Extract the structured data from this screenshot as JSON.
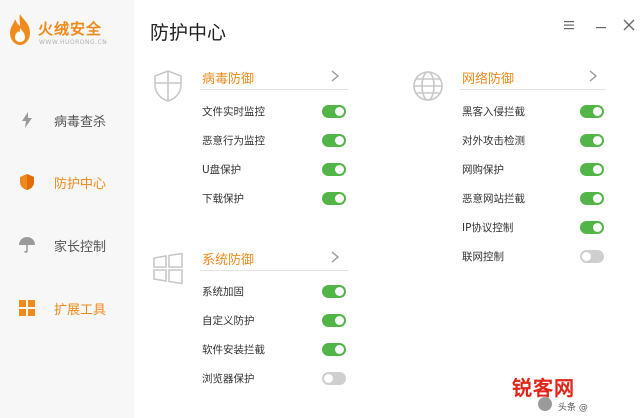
{
  "app": {
    "name": "火绒安全",
    "subtitle": "WWW.HUORONG.CN",
    "brand_color": "#f08a1c"
  },
  "sidebar": {
    "items": [
      {
        "label": "病毒查杀",
        "icon": "lightning-icon"
      },
      {
        "label": "防护中心",
        "icon": "shield-icon",
        "active": true
      },
      {
        "label": "家长控制",
        "icon": "umbrella-icon"
      },
      {
        "label": "扩展工具",
        "icon": "grid-icon"
      }
    ]
  },
  "page": {
    "title": "防护中心"
  },
  "window_controls": [
    "menu-icon",
    "minimize-icon",
    "close-icon"
  ],
  "sections": {
    "virus": {
      "title": "病毒防御",
      "icon": "shield-outline-icon",
      "items": [
        {
          "label": "文件实时监控",
          "on": true
        },
        {
          "label": "恶意行为监控",
          "on": true
        },
        {
          "label": "U盘保护",
          "on": true
        },
        {
          "label": "下载保护",
          "on": true
        }
      ]
    },
    "system": {
      "title": "系统防御",
      "icon": "windows-icon",
      "items": [
        {
          "label": "系统加固",
          "on": true
        },
        {
          "label": "自定义防护",
          "on": true
        },
        {
          "label": "软件安装拦截",
          "on": true
        },
        {
          "label": "浏览器保护",
          "on": false
        }
      ]
    },
    "network": {
      "title": "网络防御",
      "icon": "globe-icon",
      "items": [
        {
          "label": "黑客入侵拦截",
          "on": true
        },
        {
          "label": "对外攻击检测",
          "on": true
        },
        {
          "label": "网购保护",
          "on": true
        },
        {
          "label": "恶意网站拦截",
          "on": true
        },
        {
          "label": "IP协议控制",
          "on": true
        },
        {
          "label": "联网控制",
          "on": false
        }
      ]
    }
  },
  "colors": {
    "toggle_on": "#52b548",
    "toggle_off": "#cfcfcf",
    "accent": "#f08a1c"
  },
  "watermark": {
    "text": "锐客网",
    "sub": "头条 @"
  }
}
